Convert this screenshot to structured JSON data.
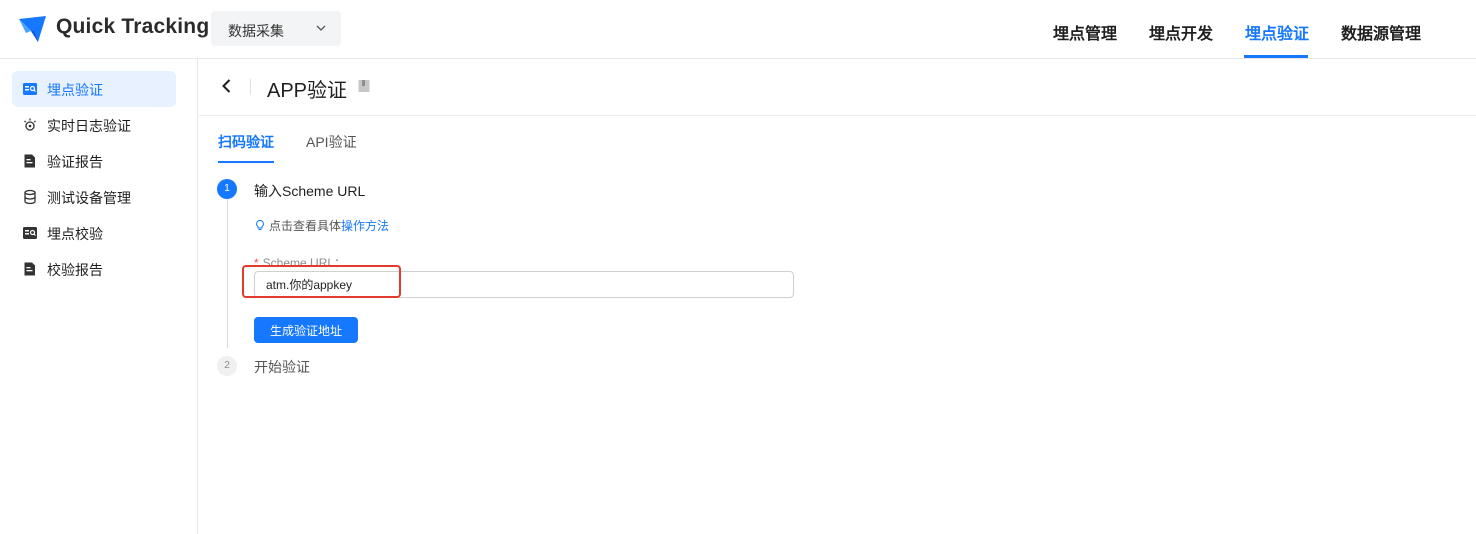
{
  "brand": {
    "name": "Quick Tracking"
  },
  "product_select": {
    "value": "数据采集"
  },
  "top_nav": {
    "items": [
      {
        "label": "埋点管理"
      },
      {
        "label": "埋点开发"
      },
      {
        "label": "埋点验证",
        "active": true
      },
      {
        "label": "数据源管理"
      }
    ]
  },
  "sidebar": {
    "items": [
      {
        "label": "埋点验证",
        "icon": "scan-verify-icon",
        "active": true
      },
      {
        "label": "实时日志验证",
        "icon": "realtime-log-icon"
      },
      {
        "label": "验证报告",
        "icon": "report-icon"
      },
      {
        "label": "测试设备管理",
        "icon": "database-icon"
      },
      {
        "label": "埋点校验",
        "icon": "scan-verify-icon"
      },
      {
        "label": "校验报告",
        "icon": "report-icon"
      }
    ]
  },
  "page": {
    "title": "APP验证",
    "tabs": [
      {
        "label": "扫码验证",
        "active": true
      },
      {
        "label": "API验证"
      }
    ],
    "steps": [
      {
        "number": "1",
        "title": "输入Scheme URL",
        "status": "active"
      },
      {
        "number": "2",
        "title": "开始验证",
        "status": "pending"
      }
    ],
    "hint": {
      "text": "点击查看具体",
      "link": "操作方法"
    },
    "field": {
      "required_mark": "*",
      "label": "Scheme URL：",
      "value": "atm.你的appkey"
    },
    "generate_button": "生成验证地址"
  },
  "colors": {
    "accent": "#1677ff",
    "highlight": "#e23b2e"
  }
}
